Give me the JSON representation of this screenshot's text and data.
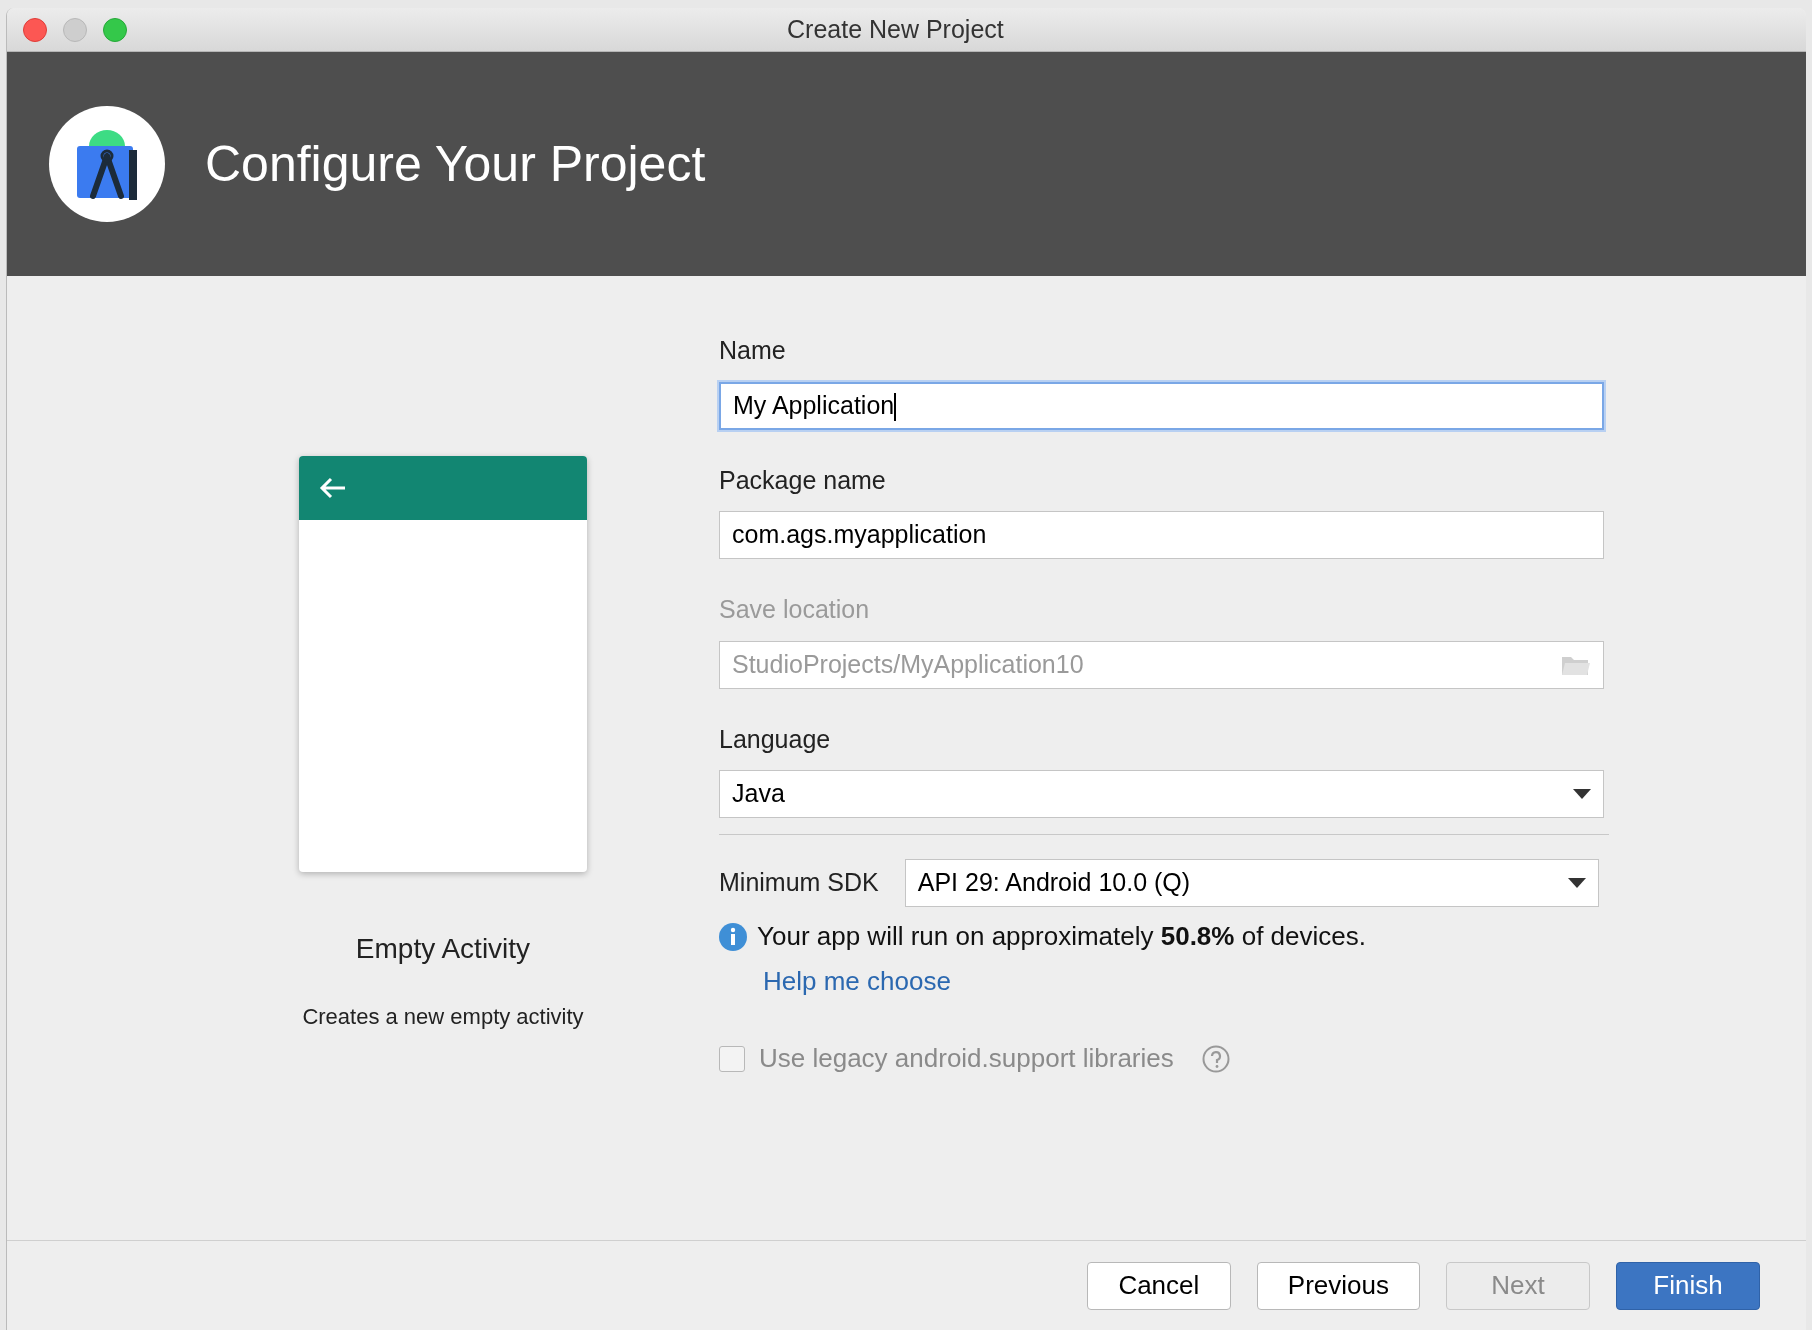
{
  "window": {
    "title": "Create New Project"
  },
  "header": {
    "title": "Configure Your Project"
  },
  "template": {
    "name": "Empty Activity",
    "description": "Creates a new empty activity"
  },
  "fields": [
    {
      "kind": "text",
      "label": "Name",
      "value": "My Application",
      "focused": true,
      "disabled": false
    },
    {
      "kind": "text",
      "label": "Package name",
      "value": "com.ags.myapplication",
      "focused": false,
      "disabled": false
    },
    {
      "kind": "folder",
      "label": "Save location",
      "value": "StudioProjects/MyApplication10",
      "focused": false,
      "disabled": true
    },
    {
      "kind": "select",
      "label": "Language",
      "value": "Java",
      "focused": false,
      "disabled": false
    }
  ],
  "min_sdk": {
    "label": "Minimum SDK",
    "value": "API 29: Android 10.0 (Q)"
  },
  "info": {
    "text": "Your app will run on approximately **50.8%** of devices.",
    "link": "Help me choose"
  },
  "legacy_checkbox": {
    "label": "Use legacy android.support libraries",
    "checked": false,
    "disabled": true
  },
  "buttons": [
    {
      "label": "Cancel",
      "kind": "normal",
      "disabled": false
    },
    {
      "label": "Previous",
      "kind": "normal",
      "disabled": false
    },
    {
      "label": "Next",
      "kind": "normal",
      "disabled": true
    },
    {
      "label": "Finish",
      "kind": "primary",
      "disabled": false
    }
  ]
}
